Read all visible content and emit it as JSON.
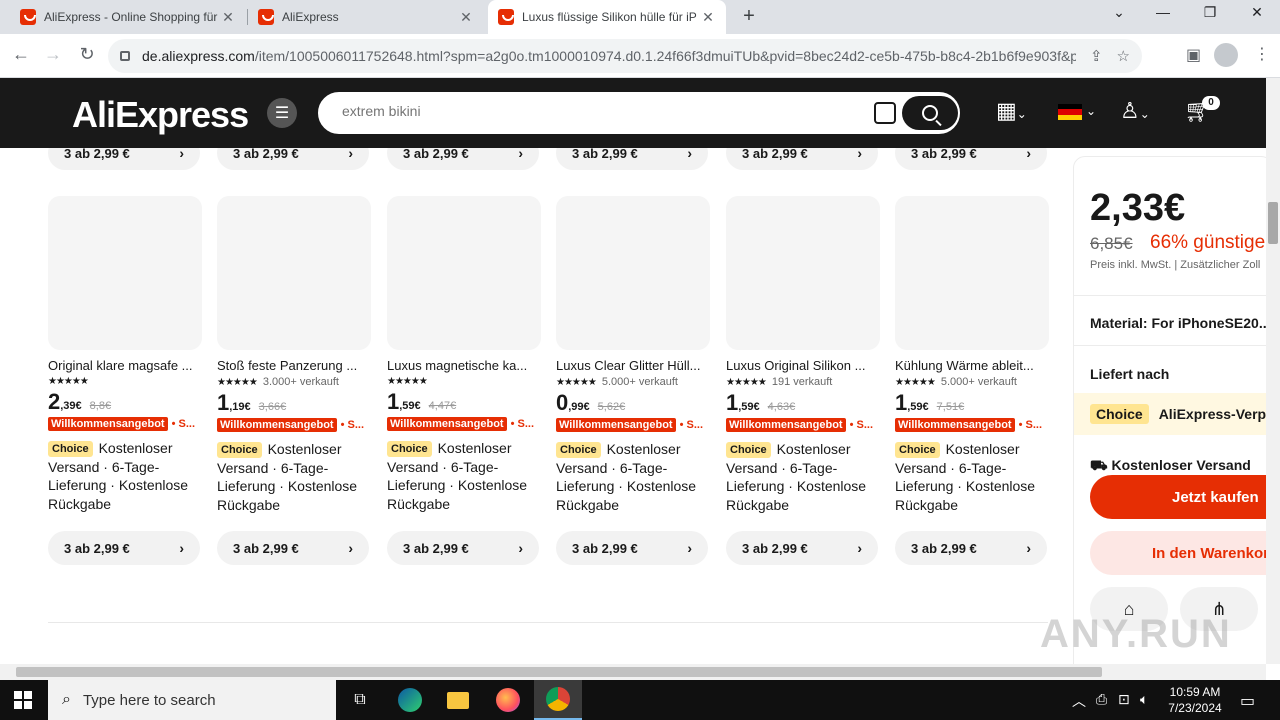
{
  "browser": {
    "tabs": [
      {
        "title": "AliExpress - Online Shopping für",
        "active": false
      },
      {
        "title": "AliExpress",
        "active": false
      },
      {
        "title": "Luxus flüssige Silikon hülle für iP",
        "active": true
      }
    ],
    "url_host": "de.aliexpress.com",
    "url_rest": "/item/1005006011752648.html?spm=a2g0o.tm1000010974.d0.1.24f66f3dmuiTUb&pvid=8bec24d2-ce5b-475b-b8c4-2b1b6f9e903f&p..."
  },
  "header": {
    "logo": "AliExpress",
    "search_placeholder": "extrem bikini",
    "cart_count": "0",
    "accent": "#e62e04"
  },
  "top_pills": [
    "3 ab 2,99 €",
    "3 ab 2,99 €",
    "3 ab 2,99 €",
    "3 ab 2,99 €",
    "3 ab 2,99 €",
    "3 ab 2,99 €"
  ],
  "products": [
    {
      "name": "Original klare magsafe ...",
      "sold": "",
      "price_int": "2",
      "price_dec": ",39€",
      "old_price": "8,8€",
      "promo": "Willkommensangebot",
      "promo_more": "• S...",
      "choice": "Choice",
      "shipping": "Kostenloser Versand · 6-Tage-Lieferung · Kostenlose Rückgabe",
      "pill": "3 ab 2,99 €"
    },
    {
      "name": "Stoß feste Panzerung ...",
      "sold": "3.000+ verkauft",
      "price_int": "1",
      "price_dec": ",19€",
      "old_price": "3,66€",
      "promo": "Willkommensangebot",
      "promo_more": "• S...",
      "choice": "Choice",
      "shipping": "Kostenloser Versand · 6-Tage-Lieferung · Kostenlose Rückgabe",
      "pill": "3 ab 2,99 €"
    },
    {
      "name": "Luxus magnetische ka...",
      "sold": "",
      "price_int": "1",
      "price_dec": ",59€",
      "old_price": "4,47€",
      "promo": "Willkommensangebot",
      "promo_more": "• S...",
      "choice": "Choice",
      "shipping": "Kostenloser Versand · 6-Tage-Lieferung · Kostenlose Rückgabe",
      "pill": "3 ab 2,99 €"
    },
    {
      "name": "Luxus Clear Glitter Hüll...",
      "sold": "5.000+ verkauft",
      "price_int": "0",
      "price_dec": ",99€",
      "old_price": "5,62€",
      "promo": "Willkommensangebot",
      "promo_more": "• S...",
      "choice": "Choice",
      "shipping": "Kostenloser Versand · 6-Tage-Lieferung · Kostenlose Rückgabe",
      "pill": "3 ab 2,99 €"
    },
    {
      "name": "Luxus Original Silikon ...",
      "sold": "191 verkauft",
      "price_int": "1",
      "price_dec": ",59€",
      "old_price": "4,63€",
      "promo": "Willkommensangebot",
      "promo_more": "• S...",
      "choice": "Choice",
      "shipping": "Kostenloser Versand · 6-Tage-Lieferung · Kostenlose Rückgabe",
      "pill": "3 ab 2,99 €"
    },
    {
      "name": "Kühlung Wärme ableit...",
      "sold": "5.000+ verkauft",
      "price_int": "1",
      "price_dec": ",59€",
      "old_price": "7,51€",
      "promo": "Willkommensangebot",
      "promo_more": "• S...",
      "choice": "Choice",
      "shipping": "Kostenloser Versand · 6-Tage-Lieferung · Kostenlose Rückgabe",
      "pill": "3 ab 2,99 €"
    }
  ],
  "panel": {
    "price": "2,33€",
    "old_price": "6,85€",
    "discount": "66% günstiger",
    "tax_note": "Preis inkl. MwSt. | Zusätzlicher Zoll",
    "material": "Material: For iPhoneSE20...",
    "delivery": "Liefert nach",
    "choice_tag": "Choice",
    "choice_text": "AliExpress-Verpflichtung",
    "shipping": "Kostenloser Versand",
    "buy_now": "Jetzt kaufen",
    "add_to_cart": "In den Warenkorb"
  },
  "watermark": "ANY.RUN",
  "taskbar": {
    "search_placeholder": "Type here to search",
    "time": "10:59 AM",
    "date": "7/23/2024"
  }
}
